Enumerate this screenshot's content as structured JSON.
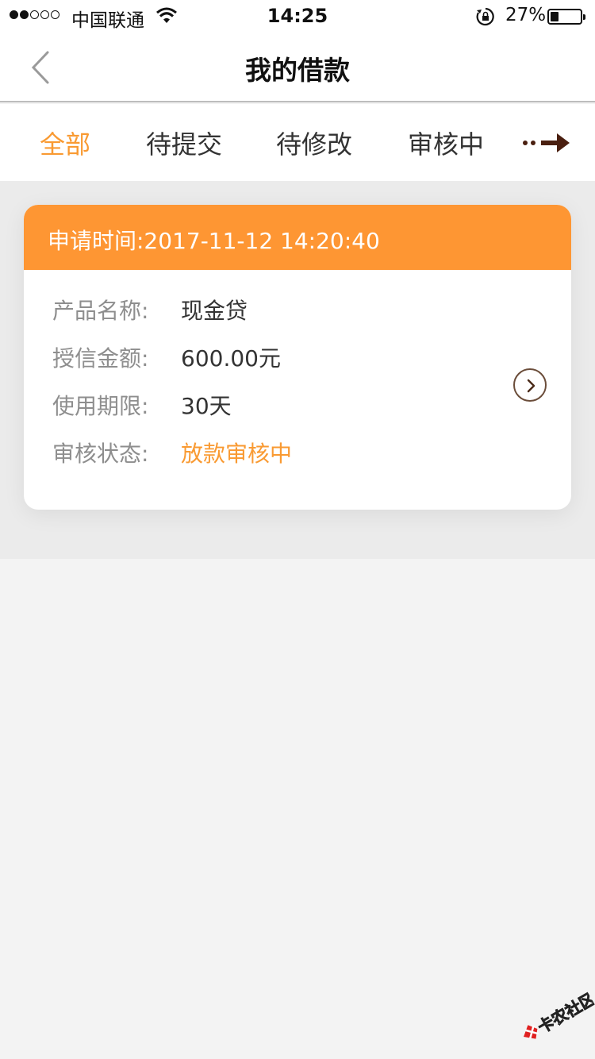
{
  "status_bar": {
    "carrier": "中国联通",
    "time": "14:25",
    "battery": "27%",
    "signal_bars_filled": 2,
    "signal_bars_total": 5,
    "battery_level": 0.27
  },
  "nav": {
    "title": "我的借款",
    "back_icon": "chevron-left-icon"
  },
  "tabs": [
    {
      "label": "全部",
      "active": true
    },
    {
      "label": "待提交",
      "active": false
    },
    {
      "label": "待修改",
      "active": false
    },
    {
      "label": "审核中",
      "active": false
    }
  ],
  "tabs_more_icon": "dots-arrow-right-icon",
  "colors": {
    "accent": "#f99a32",
    "card_header": "#fe9633"
  },
  "loan_card": {
    "header": "申请时间:2017-11-12 14:20:40",
    "fields": [
      {
        "label": "产品名称:",
        "value": "现金贷"
      },
      {
        "label": "授信金额:",
        "value": "600.00元"
      },
      {
        "label": "使用期限:",
        "value": "30天"
      },
      {
        "label": "审核状态:",
        "value": "放款审核中"
      }
    ],
    "arrow_icon": "circle-chevron-right-icon"
  },
  "watermark": {
    "text": "卡农社区"
  }
}
